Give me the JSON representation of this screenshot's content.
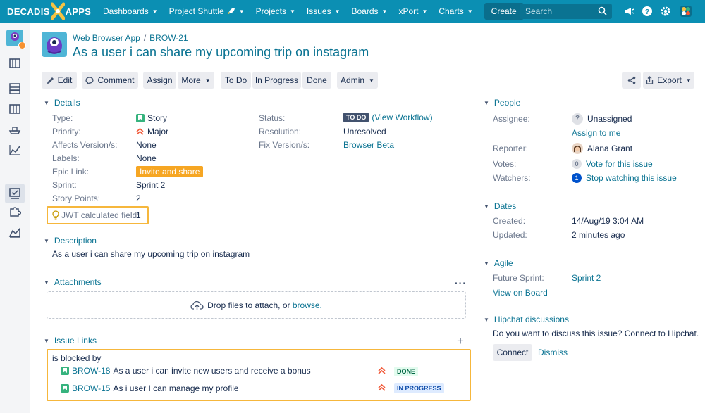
{
  "topnav": {
    "logo_left": "DECADIS",
    "logo_right": "APPS",
    "items": [
      {
        "label": "Dashboards"
      },
      {
        "label": "Project Shuttle"
      },
      {
        "label": "Projects"
      },
      {
        "label": "Issues"
      },
      {
        "label": "Boards"
      },
      {
        "label": "xPort"
      },
      {
        "label": "Charts"
      }
    ],
    "create": "Create",
    "search_placeholder": "Search"
  },
  "breadcrumbs": {
    "project": "Web Browser App",
    "issue_key": "BROW-21"
  },
  "summary": "As a user i can share my upcoming trip on instagram",
  "toolbar": {
    "edit": "Edit",
    "comment": "Comment",
    "assign": "Assign",
    "more": "More",
    "todo": "To Do",
    "in_progress": "In Progress",
    "done": "Done",
    "admin": "Admin",
    "export": "Export"
  },
  "details": {
    "title": "Details",
    "type": {
      "label": "Type:",
      "value": "Story"
    },
    "priority": {
      "label": "Priority:",
      "value": "Major"
    },
    "affects": {
      "label": "Affects Version/s:",
      "value": "None"
    },
    "labels": {
      "label": "Labels:",
      "value": "None"
    },
    "epic": {
      "label": "Epic Link:",
      "value": "Invite and share"
    },
    "sprint": {
      "label": "Sprint:",
      "value": "Sprint 2"
    },
    "points": {
      "label": "Story Points:",
      "value": "2"
    },
    "jwt": {
      "label": "JWT calculated field:",
      "value": "1"
    },
    "status": {
      "label": "Status:",
      "value": "TO DO",
      "workflow": "(View Workflow)"
    },
    "resolution": {
      "label": "Resolution:",
      "value": "Unresolved"
    },
    "fix": {
      "label": "Fix Version/s:",
      "value": "Browser Beta"
    }
  },
  "description": {
    "title": "Description",
    "text": "As a user i can share my upcoming trip on instagram"
  },
  "attachments": {
    "title": "Attachments",
    "drop_text": "Drop files to attach, or",
    "browse": "browse."
  },
  "issue_links": {
    "title": "Issue Links",
    "relation": "is blocked by",
    "links": [
      {
        "key": "BROW-18",
        "summary": "As a user i can invite new users and receive a bonus",
        "status": "DONE"
      },
      {
        "key": "BROW-15",
        "summary": "As i user I can manage my profile",
        "status": "IN PROGRESS"
      }
    ]
  },
  "people": {
    "title": "People",
    "assignee_label": "Assignee:",
    "assignee": "Unassigned",
    "assign_to_me": "Assign to me",
    "reporter_label": "Reporter:",
    "reporter": "Alana Grant",
    "votes_label": "Votes:",
    "votes_count": "0",
    "vote_link": "Vote for this issue",
    "watchers_label": "Watchers:",
    "watchers_count": "1",
    "watch_link": "Stop watching this issue"
  },
  "dates": {
    "title": "Dates",
    "created_label": "Created:",
    "created": "14/Aug/19 3:04 AM",
    "updated_label": "Updated:",
    "updated": "2 minutes ago"
  },
  "agile": {
    "title": "Agile",
    "future_label": "Future Sprint:",
    "future": "Sprint 2",
    "view_board": "View on Board"
  },
  "hipchat": {
    "title": "Hipchat discussions",
    "prompt": "Do you want to discuss this issue? Connect to Hipchat.",
    "connect": "Connect",
    "dismiss": "Dismiss"
  },
  "colors": {
    "brand": "#0b8fb3",
    "link": "#0a7392",
    "highlight": "#f6b73c"
  }
}
